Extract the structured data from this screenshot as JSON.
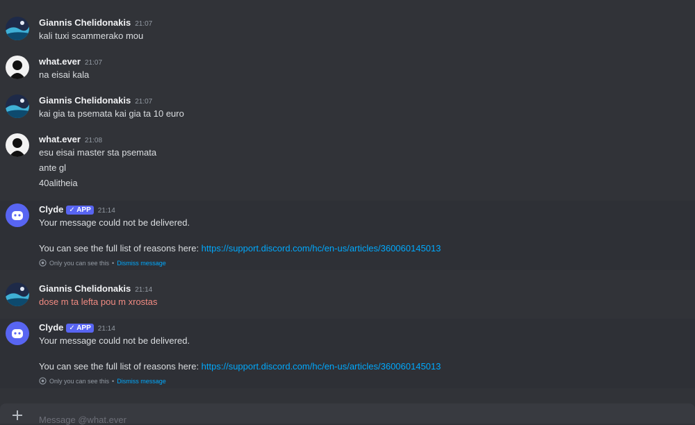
{
  "messages": [
    {
      "author": "Giannis Chelidonakis",
      "time": "21:07",
      "lines": [
        "kali tuxi scammerako mou"
      ]
    },
    {
      "author": "what.ever",
      "time": "21:07",
      "lines": [
        "na eisai kala"
      ]
    },
    {
      "author": "Giannis Chelidonakis",
      "time": "21:07",
      "lines": [
        "kai gia ta psemata kai gia ta 10 euro"
      ]
    },
    {
      "author": "what.ever",
      "time": "21:08",
      "lines": [
        "esu eisai master sta psemata",
        "ante gl",
        "40alitheia"
      ]
    },
    {
      "author": "Clyde",
      "tag": "APP",
      "time": "21:14",
      "line1": "Your message could not be delivered.",
      "line2_prefix": "You can see the full list of reasons here: ",
      "line2_link": "https://support.discord.com/hc/en-us/articles/360060145013",
      "ephemeral_text": "Only you can see this",
      "dismiss": "Dismiss message"
    },
    {
      "author": "Giannis Chelidonakis",
      "time": "21:14",
      "lines": [
        "dose m ta lefta pou m xrostas"
      ],
      "failed": true
    },
    {
      "author": "Clyde",
      "tag": "APP",
      "time": "21:14",
      "line1": "Your message could not be delivered.",
      "line2_prefix": "You can see the full list of reasons here: ",
      "line2_link": "https://support.discord.com/hc/en-us/articles/360060145013",
      "ephemeral_text": "Only you can see this",
      "dismiss": "Dismiss message"
    }
  ],
  "composer": {
    "placeholder": "Message @what.ever"
  },
  "colors": {
    "background": "#313338",
    "link": "#00a8fc",
    "app_tag": "#5865f2",
    "failed_text": "#f28b82"
  }
}
